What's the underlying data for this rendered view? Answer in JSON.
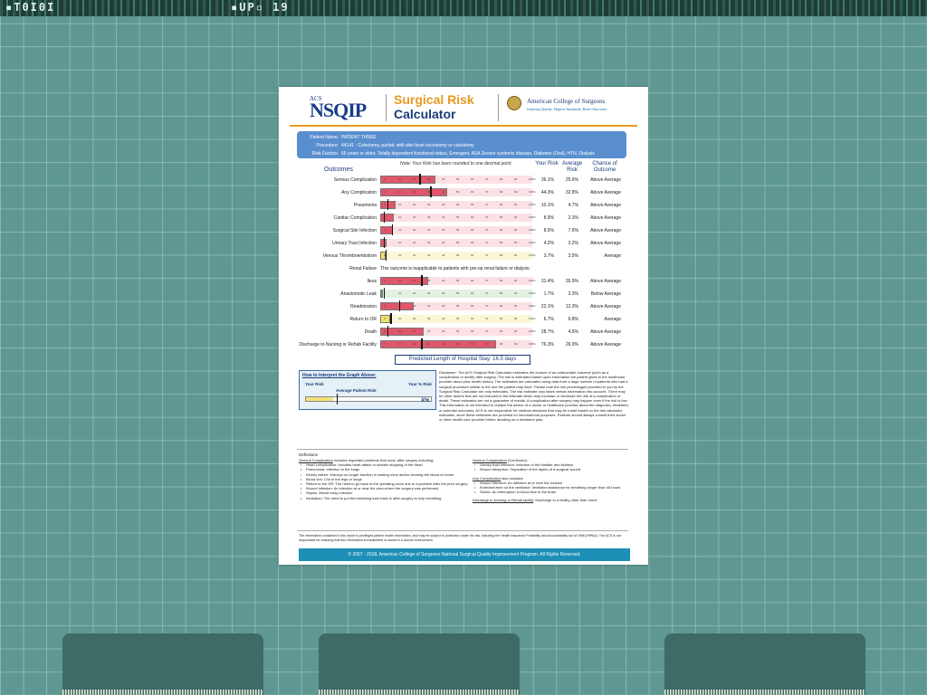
{
  "desktop": {
    "topbar_left": "▪T0I0I",
    "topbar_mid": "▪UP▫ 19"
  },
  "report": {
    "logo_small": "ACS",
    "logo_main": "NSQIP",
    "title_line1": "Surgical Risk",
    "title_line2": "Calculator",
    "org_name": "American College of Surgeons",
    "org_tagline": "Inspiring Quality: Highest Standards, Better Outcomes",
    "patient": {
      "name_label": "Patient Name:",
      "name": "PATIENT THREE",
      "procedure_label": "Procedure:",
      "procedure": "44141 - Colectomy, partial; with skin level cecostomy or colostomy",
      "risk_label": "Risk Factors:",
      "risk_factors": "65 years or older, Totally dependent functional status, Emergent, ASA Severe systemic disease, Diabetes (Oral), HTN, Dialysis"
    },
    "note": "Note: Your Risk has been rounded to one decimal point.",
    "headers": {
      "outcomes": "Outcomes",
      "your_risk": "Your Risk",
      "average_risk": "Average Risk",
      "chance": "Chance of Outcome"
    },
    "ticks": [
      "0",
      "10",
      "20",
      "30",
      "40",
      "50",
      "60",
      "70",
      "80",
      "90",
      "100%"
    ],
    "outcomes": [
      {
        "label": "Serious Complication",
        "your": "36.1%",
        "avg": "25.6%",
        "chance": "Above Average",
        "your_pct": 36.1,
        "avg_pct": 25.6,
        "color": "#e0566a"
      },
      {
        "label": "Any Complication",
        "your": "44.3%",
        "avg": "32.8%",
        "chance": "Above Average",
        "your_pct": 44.3,
        "avg_pct": 32.8,
        "color": "#e0566a"
      },
      {
        "label": "Pneumonia",
        "your": "10.1%",
        "avg": "4.7%",
        "chance": "Above Average",
        "your_pct": 10.1,
        "avg_pct": 4.7,
        "color": "#e0566a"
      },
      {
        "label": "Cardiac Complication",
        "your": "8.9%",
        "avg": "2.3%",
        "chance": "Above Average",
        "your_pct": 8.9,
        "avg_pct": 2.3,
        "color": "#e0566a"
      },
      {
        "label": "Surgical Site Infection",
        "your": "8.5%",
        "avg": "7.6%",
        "chance": "Above Average",
        "your_pct": 8.5,
        "avg_pct": 7.6,
        "color": "#e0566a"
      },
      {
        "label": "Urinary Tract Infection",
        "your": "4.2%",
        "avg": "2.2%",
        "chance": "Above Average",
        "your_pct": 4.2,
        "avg_pct": 2.2,
        "color": "#e0566a"
      },
      {
        "label": "Venous Thromboembolism",
        "your": "3.7%",
        "avg": "3.5%",
        "chance": "Average",
        "your_pct": 3.7,
        "avg_pct": 3.5,
        "color": "#eee266"
      },
      {
        "label": "Renal Failure",
        "renal_text": "This outcome is inapplicable to patients with pre-op renal failure or dialysis."
      },
      {
        "label": "Ileus",
        "your": "31.4%",
        "avg": "26.9%",
        "chance": "Above Average",
        "your_pct": 31.4,
        "avg_pct": 26.9,
        "color": "#e0566a"
      },
      {
        "label": "Anastomotic Leak",
        "your": "1.7%",
        "avg": "2.3%",
        "chance": "Below Average",
        "your_pct": 1.7,
        "avg_pct": 2.3,
        "color": "#5fa35f"
      },
      {
        "label": "Readmission",
        "your": "22.1%",
        "avg": "12.3%",
        "chance": "Above Average",
        "your_pct": 22.1,
        "avg_pct": 12.3,
        "color": "#e0566a"
      },
      {
        "label": "Return to OR",
        "your": "6.7%",
        "avg": "6.8%",
        "chance": "Average",
        "your_pct": 6.7,
        "avg_pct": 6.8,
        "color": "#eee266"
      },
      {
        "label": "Death",
        "your": "28.7%",
        "avg": "4.5%",
        "chance": "Above Average",
        "your_pct": 28.7,
        "avg_pct": 4.5,
        "color": "#e0566a"
      },
      {
        "label": "Discharge to Nursing or Rehab Facility",
        "your": "76.3%",
        "avg": "26.9%",
        "chance": "Above Average",
        "your_pct": 76.3,
        "avg_pct": 26.9,
        "color": "#e0566a"
      }
    ],
    "los": "Predicted Length of Hospital Stay: 16.5 days",
    "interpret": {
      "title": "How to Interpret the Graph Above:",
      "your_risk": "Your Risk",
      "avg_risk": "Average Patient Risk",
      "pct_risk": "Your % Risk",
      "pct": "X%"
    },
    "disclaimer": "Disclaimer: The ACS Surgical Risk Calculator estimates the chance of an unfavorable outcome (such as a complication or death) after surgery. The risk is estimated based upon information the patient gives to the healthcare provider about prior health history. The estimates are calculated using data from a large number of patients who had a surgical procedure similar to the one the patient may have. Please note the risk percentages provided to you by the Surgical Risk Calculator are only estimates. The risk estimate only takes certain information into account. There may be other factors that are not included in the estimate which may increase or decrease the risk of a complication or death. These estimates are not a guarantee of results. A complication after surgery may happen even if the risk is low. This information is not intended to replace the advice of a doctor or healthcare provider about the diagnosis, treatment, or potential outcomes. ACS is not responsible for medical decisions that may be made based on the risk calculator estimates, since these estimates are provided for informational purposes. Patients should always consult their doctor or other health care provider before deciding on a treatment plan.",
    "defs_title": "Definitions",
    "defs_left_head": "Serious Complication",
    "defs_left_intro": " includes important problems that occur after surgery including:",
    "defs_left": [
      "Heart complication: Includes heart attack or sudden stopping of the heart",
      "Pneumonia: Infection in the lungs",
      "Kidney failure: Kidneys no longer function in making urine and/or clearing the blood of toxins",
      "Blood clot: Clot in the legs or lungs",
      "Return to the OR: The need to go back to the operating room due to a problem after the prior surgery",
      "Wound infection: An infection at or near the area where the surgery was performed",
      "Sepsis: Whole body infection",
      "Intubation: The need to put the breathing tube back in after surgery to help breathing"
    ],
    "defs_right_head": "Serious Complication",
    "defs_right_cont": " (Continued):",
    "defs_right": [
      "Urinary tract infection: Infection of the bladder and kidneys",
      "Wound disruption: Separation of the layers of a surgical wound"
    ],
    "any_head": "Any Complication",
    "any_intro": " also includes:",
    "any_list": [
      "Wound Infection: An infection at or near the incision",
      "Extended time on the ventilator: Ventilator assistance for breathing longer than 48 hours",
      "Stroke: An interruption in blood flow to the brain"
    ],
    "discharge_head": "Discharge to Nursing or Rehab facility",
    "discharge_text": ": Discharge to a facility other than home",
    "legal": "The information contained in this report is privileged patient health information, and may be subject to protection under the law, including the Health Insurance Portability and Accountability Act of 1996 (HIPAA). The ACS is not responsible for ensuring that this information is transmitted or stored in a secure environment.",
    "footer": "© 2007 - 2018, American College of Surgeons National Surgical Quality Improvement Program. All Rights Reserved."
  }
}
